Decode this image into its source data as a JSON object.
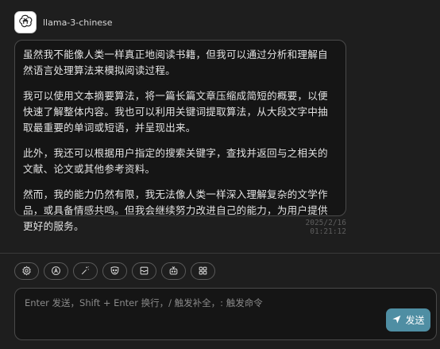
{
  "message": {
    "model_name": "llama-3-chinese",
    "avatar_icon": "openai-logo-icon",
    "paragraphs": [
      "虽然我不能像人类一样真正地阅读书籍，但我可以通过分析和理解自然语言处理算法来模拟阅读过程。",
      "我可以使用文本摘要算法，将一篇长篇文章压缩成简短的概要，以便快速了解整体内容。我也可以利用关键词提取算法，从大段文字中抽取最重要的单词或短语，并呈现出来。",
      "此外，我还可以根据用户指定的搜索关键字，查找并返回与之相关的文献、论文或其他参考资料。",
      "然而，我的能力仍然有限，我无法像人类一样深入理解复杂的文学作品，或具备情感共鸣。但我会继续努力改进自己的能力，为用户提供更好的服务。"
    ],
    "timestamp": "2025/2/16 01:21:12"
  },
  "toolbar": {
    "buttons": [
      {
        "icon": "settings-gear-icon"
      },
      {
        "icon": "theme-auto-icon"
      },
      {
        "icon": "magic-wand-icon"
      },
      {
        "icon": "mask-face-icon"
      },
      {
        "icon": "clear-context-icon"
      },
      {
        "icon": "robot-icon"
      },
      {
        "icon": "grid-apps-icon"
      }
    ]
  },
  "input": {
    "placeholder": "Enter 发送，Shift + Enter 换行，/ 触发补全，: 触发命令",
    "value": ""
  },
  "send": {
    "label": "发送",
    "icon": "send-arrow-icon",
    "color": "#4f8ea3"
  }
}
